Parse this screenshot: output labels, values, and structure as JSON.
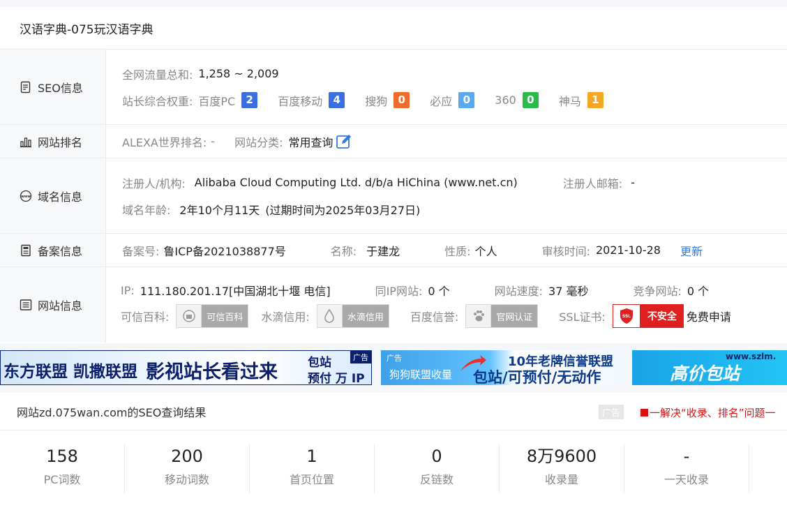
{
  "header": {
    "title": "汉语字典-075玩汉语字典"
  },
  "seo": {
    "head": "SEO信息",
    "traffic_label": "全网流量总和:",
    "traffic_value": "1,258 ~ 2,009",
    "weight_label": "站长综合权重:",
    "weights": [
      {
        "name": "百度PC",
        "value": "2",
        "color": "#3b6fe0"
      },
      {
        "name": "百度移动",
        "value": "4",
        "color": "#3b6fe0"
      },
      {
        "name": "搜狗",
        "value": "0",
        "color": "#f06a2a"
      },
      {
        "name": "必应",
        "value": "0",
        "color": "#5aa8f0"
      },
      {
        "name": "360",
        "value": "0",
        "color": "#2bbb48"
      },
      {
        "name": "神马",
        "value": "1",
        "color": "#f5a623"
      }
    ]
  },
  "rank": {
    "head": "网站排名",
    "alexa_label": "ALEXA世界排名:",
    "alexa_value": "-",
    "category_label": "网站分类:",
    "category_value": "常用查询"
  },
  "domain": {
    "head": "域名信息",
    "registrant_label": "注册人/机构:",
    "registrant_value": "Alibaba Cloud Computing Ltd. d/b/a HiChina (www.net.cn)",
    "email_label": "注册人邮箱:",
    "email_value": "-",
    "age_label": "域名年龄:",
    "age_value": "2年10个月11天",
    "expire_value": "(过期时间为2025年03月27日)"
  },
  "icp": {
    "head": "备案信息",
    "no_label": "备案号:",
    "no_value": "鲁ICP备2021038877号",
    "name_label": "名称:",
    "name_value": "于建龙",
    "type_label": "性质:",
    "type_value": "个人",
    "time_label": "审核时间:",
    "time_value": "2021-10-28",
    "update_link": "更新"
  },
  "site": {
    "head": "网站信息",
    "ip_label": "IP:",
    "ip_value": "111.180.201.17[中国湖北十堰 电信]",
    "sameip_label": "同IP网站:",
    "sameip_value": "0 个",
    "speed_label": "网站速度:",
    "speed_value": "37 毫秒",
    "compete_label": "竞争网站:",
    "compete_value": "0 个",
    "kexin_label": "可信百科:",
    "kexin_badge": "可信百科",
    "shuidi_label": "水滴信用:",
    "shuidi_badge": "水滴信用",
    "baidu_label": "百度信誉:",
    "baidu_badge": "官网认证",
    "ssl_label": "SSL证书:",
    "ssl_icon_text": "SSL",
    "ssl_badge": "不安全",
    "ssl_link": "免费申请"
  },
  "ads": {
    "ad1_text": "东方联盟 凯撒联盟",
    "ad1_text2": "影视站长看过来",
    "ad1_text3a": "包站",
    "ad1_text3b": "预付 万 IP",
    "ad1_tag": "广告",
    "ad2_tag": "广告",
    "ad2_left": "狗狗联盟收量",
    "ad2_top": "10年老牌信誉联盟",
    "ad2_bottom": "包站/可预付/无动作",
    "ad3_url": "www.szlm.",
    "ad3_text": "高价包站"
  },
  "result": {
    "title": "网站zd.075wan.com的SEO查询结果",
    "ad_tag": "广告",
    "promo": "一解决“收录、排名”问题一",
    "stats": [
      {
        "value": "158",
        "label": "PC词数"
      },
      {
        "value": "200",
        "label": "移动词数"
      },
      {
        "value": "1",
        "label": "首页位置"
      },
      {
        "value": "0",
        "label": "反链数"
      },
      {
        "value": "8万9600",
        "label": "收录量"
      },
      {
        "value": "-",
        "label": "一天收录"
      }
    ]
  }
}
